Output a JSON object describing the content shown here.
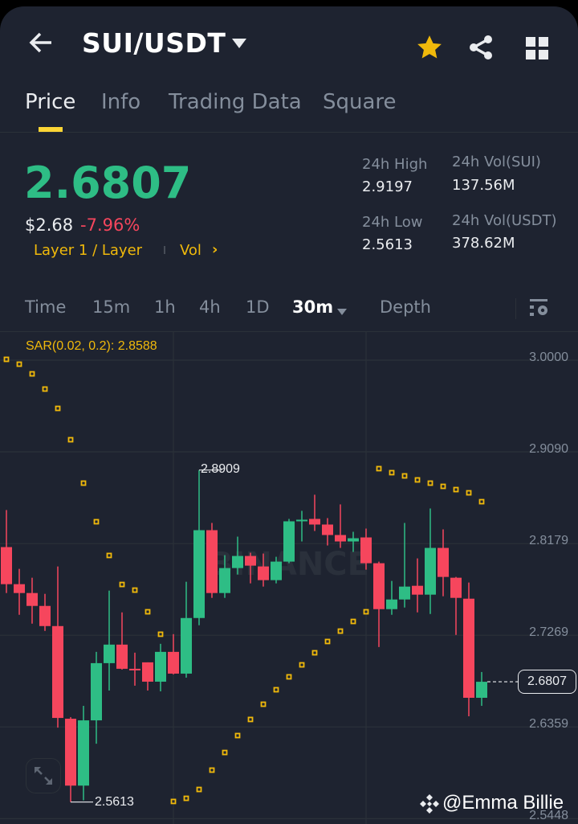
{
  "header": {
    "title": "SUI/USDT",
    "icons": [
      "back-arrow-icon",
      "dropdown-triangle-icon",
      "star-icon",
      "share-icon",
      "grid-icon"
    ]
  },
  "tabs": [
    {
      "label": "Price"
    },
    {
      "label": "Info"
    },
    {
      "label": "Trading Data"
    },
    {
      "label": "Square"
    }
  ],
  "ticker": {
    "last_price": "2.6807",
    "usd_price": "$2.68",
    "change": "-7.96%",
    "category": "Layer 1 / Layer",
    "vol_link": "Vol",
    "stats": [
      {
        "label": "24h High",
        "value": "2.9197"
      },
      {
        "label": "24h Vol(SUI)",
        "value": "137.56M"
      },
      {
        "label": "24h Low",
        "value": "2.5613"
      },
      {
        "label": "24h Vol(USDT)",
        "value": "378.62M"
      }
    ]
  },
  "timeframes": [
    {
      "label": "Time"
    },
    {
      "label": "15m"
    },
    {
      "label": "1h"
    },
    {
      "label": "4h"
    },
    {
      "label": "1D"
    },
    {
      "label": "30m"
    },
    {
      "label": "Depth"
    }
  ],
  "colors": {
    "up": "#2ebd85",
    "down": "#f6465d",
    "accent": "#f0b90b",
    "bg": "#1e2330"
  },
  "watermark": "@Emma Billie",
  "chart_data": {
    "type": "candlestick",
    "interval": "30m",
    "indicator": "SAR(0.02, 0.2): 2.8588",
    "ylim": [
      2.5448,
      3.0
    ],
    "y_ticks": [
      "3.0000",
      "2.9090",
      "2.8179",
      "2.7269",
      "2.6359",
      "2.5448"
    ],
    "high_label": "2.8909",
    "low_label": "2.5613",
    "current_price": "2.6807",
    "ohlc": [
      [
        2.8144,
        2.8512,
        2.7688,
        2.7776
      ],
      [
        2.7776,
        2.7928,
        2.7472,
        2.7688
      ],
      [
        2.7688,
        2.784,
        2.7384,
        2.756
      ],
      [
        2.756,
        2.768,
        2.7312,
        2.736
      ],
      [
        2.736,
        2.7952,
        2.6352,
        2.6448
      ],
      [
        2.644,
        2.6456,
        2.5613,
        2.5776
      ],
      [
        2.5776,
        2.6568,
        2.563,
        2.6424
      ],
      [
        2.6424,
        2.7104,
        2.6192,
        2.6992
      ],
      [
        2.6992,
        2.7712,
        2.672,
        2.7176
      ],
      [
        2.7176,
        2.7496,
        2.6928,
        2.6936
      ],
      [
        2.6936,
        2.7096,
        2.6768,
        2.692
      ],
      [
        2.7,
        2.7,
        2.672,
        2.6808
      ],
      [
        2.6808,
        2.7184,
        2.6712,
        2.7104
      ],
      [
        2.7104,
        2.728,
        2.688,
        2.6888
      ],
      [
        2.6888,
        2.78,
        2.6848,
        2.744
      ],
      [
        2.744,
        2.8909,
        2.7368,
        2.8312
      ],
      [
        2.8312,
        2.8384,
        2.764,
        2.7688
      ],
      [
        2.7688,
        2.8064,
        2.764,
        2.7936
      ],
      [
        2.7936,
        2.8248,
        2.7872,
        2.8056
      ],
      [
        2.8056,
        2.8088,
        2.7784,
        2.796
      ],
      [
        2.7952,
        2.808,
        2.7752,
        2.7816
      ],
      [
        2.7816,
        2.8048,
        2.7784,
        2.8
      ],
      [
        2.8,
        2.8424,
        2.7984,
        2.84
      ],
      [
        2.84,
        2.8504,
        2.82,
        2.8416
      ],
      [
        2.8424,
        2.8664,
        2.8304,
        2.8368
      ],
      [
        2.8368,
        2.8432,
        2.816,
        2.8264
      ],
      [
        2.8264,
        2.8568,
        2.8136,
        2.82
      ],
      [
        2.82,
        2.8296,
        2.8096,
        2.8232
      ],
      [
        2.824,
        2.8328,
        2.792,
        2.7984
      ],
      [
        2.7984,
        2.8,
        2.7152,
        2.7528
      ],
      [
        2.7528,
        2.7808,
        2.7472,
        2.7624
      ],
      [
        2.7624,
        2.8384,
        2.7544,
        2.7752
      ],
      [
        2.776,
        2.8032,
        2.7496,
        2.7672
      ],
      [
        2.7672,
        2.8528,
        2.748,
        2.8136
      ],
      [
        2.8136,
        2.832,
        2.7656,
        2.7848
      ],
      [
        2.784,
        2.7848,
        2.7272,
        2.764
      ],
      [
        2.7632,
        2.7792,
        2.6464,
        2.6648
      ],
      [
        2.6648,
        2.6904,
        2.6568,
        2.6807
      ]
    ],
    "sar": [
      3.0008,
      2.996,
      2.9864,
      2.9713,
      2.9521,
      2.921,
      2.8779,
      2.8396,
      2.8061,
      2.7773,
      2.7717,
      2.7502,
      2.7279,
      2.5619,
      2.565,
      2.5738,
      2.593,
      2.6105,
      2.6273,
      2.6433,
      2.6584,
      2.6728,
      2.6856,
      2.6975,
      2.7095,
      2.7207,
      2.731,
      2.7406,
      2.7502,
      2.8923,
      2.8883,
      2.8851,
      2.8811,
      2.8779,
      2.8747,
      2.8715,
      2.8683,
      2.8595
    ]
  }
}
